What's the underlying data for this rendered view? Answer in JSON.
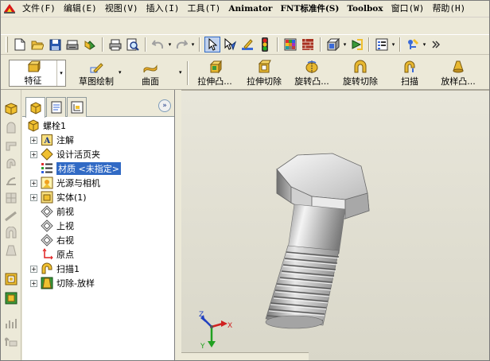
{
  "menu": {
    "items": [
      {
        "label": "文件(F)",
        "bold": false
      },
      {
        "label": "编辑(E)",
        "bold": false
      },
      {
        "label": "视图(V)",
        "bold": false
      },
      {
        "label": "插入(I)",
        "bold": false
      },
      {
        "label": "工具(T)",
        "bold": false
      },
      {
        "label": "Animator",
        "bold": true
      },
      {
        "label": "FNT标准件(S)",
        "bold": true
      },
      {
        "label": "Toolbox",
        "bold": true
      },
      {
        "label": "窗口(W)",
        "bold": false
      },
      {
        "label": "帮助(H)",
        "bold": false
      }
    ]
  },
  "command_manager": {
    "feature_tab": "特征",
    "sketch_tab": "草图绘制",
    "surface_tab": "曲面",
    "extrude_boss": "拉伸凸...",
    "extrude_cut": "拉伸切除",
    "revolve_boss": "旋转凸...",
    "revolve_cut": "旋转切除",
    "sweep": "扫描",
    "loft": "放样凸..."
  },
  "feature_tree": {
    "root": "螺栓1",
    "items": [
      {
        "label": "注解",
        "icon": "annotation-icon",
        "expandable": true
      },
      {
        "label": "设计活页夹",
        "icon": "binder-icon",
        "expandable": true
      },
      {
        "label": "材质 <未指定>",
        "icon": "material-icon",
        "expandable": false,
        "selected": true
      },
      {
        "label": "光源与相机",
        "icon": "lights-icon",
        "expandable": true
      },
      {
        "label": "实体(1)",
        "icon": "solid-bodies-icon",
        "expandable": true
      },
      {
        "label": "前视",
        "icon": "plane-icon",
        "expandable": false
      },
      {
        "label": "上视",
        "icon": "plane-icon",
        "expandable": false
      },
      {
        "label": "右视",
        "icon": "plane-icon",
        "expandable": false
      },
      {
        "label": "原点",
        "icon": "origin-icon",
        "expandable": false
      },
      {
        "label": "扫描1",
        "icon": "sweep-icon",
        "expandable": true
      },
      {
        "label": "切除-放样",
        "icon": "cut-loft-icon",
        "expandable": true
      }
    ]
  },
  "triad": {
    "x": "X",
    "y": "Y",
    "z": "Z"
  },
  "colors": {
    "selection": "#316ac5",
    "background": "#ece9d8",
    "accent_yellow": "#f5c518"
  }
}
